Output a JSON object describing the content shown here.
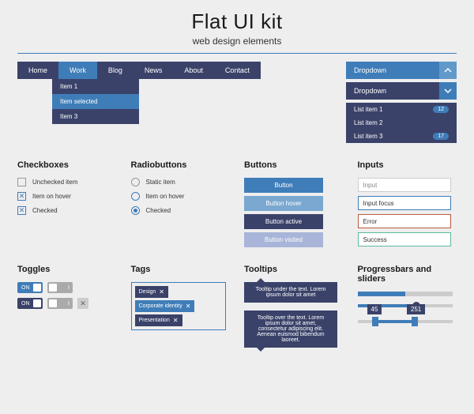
{
  "header": {
    "title": "Flat UI kit",
    "subtitle": "web design elements"
  },
  "nav": {
    "items": [
      "Home",
      "Work",
      "Blog",
      "News",
      "About",
      "Contact"
    ],
    "active": 1
  },
  "submenu": [
    "Item 1",
    "Item selected",
    "Item 3"
  ],
  "dropdown": {
    "label1": "Dropdown",
    "label2": "Dropdown",
    "list": [
      {
        "label": "List item 1",
        "badge": "12"
      },
      {
        "label": "List item 2",
        "badge": null
      },
      {
        "label": "List item 3",
        "badge": "17"
      }
    ]
  },
  "sections": {
    "checkboxes": "Checkboxes",
    "radios": "Radiobuttons",
    "buttons": "Buttons",
    "inputs": "Inputs",
    "toggles": "Toggles",
    "tags": "Tags",
    "tooltips": "Tooltips",
    "progress": "Progressbars and sliders"
  },
  "checkboxes": [
    {
      "label": "Unchecked item",
      "state": ""
    },
    {
      "label": "Item on hover",
      "state": "hover"
    },
    {
      "label": "Checked",
      "state": "checked"
    }
  ],
  "radios": [
    {
      "label": "Static item",
      "state": ""
    },
    {
      "label": "Item on hover",
      "state": "hover"
    },
    {
      "label": "Checked",
      "state": "checked"
    }
  ],
  "buttons": [
    "Button",
    "Button hover",
    "Button active",
    "Button visited"
  ],
  "inputs": [
    {
      "text": "Input",
      "cls": ""
    },
    {
      "text": "Input focus",
      "cls": "focus"
    },
    {
      "text": "Error",
      "cls": "error"
    },
    {
      "text": "Success",
      "cls": "success"
    }
  ],
  "toggles": {
    "on": "ON",
    "off": "I"
  },
  "tags": [
    "Design",
    "Corporate identity",
    "Presentation"
  ],
  "tooltips": {
    "top": "Tooltip under the text. Lorem ipsum dolor sit amet",
    "bot": "Tooltip over the text. Lorem ipsum dolor sit amet, consectetur adipiscing elit. Aenean euismod bibendum laoreet."
  },
  "progress": {
    "p1": 50,
    "slider": 62,
    "range": {
      "a": 18,
      "b": 60,
      "la": "45",
      "lb": "251"
    }
  }
}
